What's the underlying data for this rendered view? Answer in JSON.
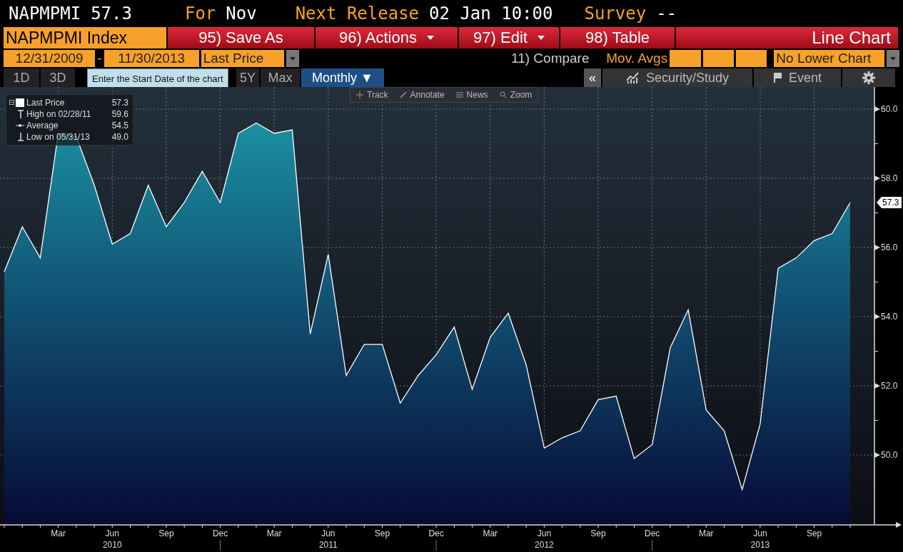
{
  "header": {
    "ticker": "NAPMPMI",
    "value": "57.3",
    "for_label": "For",
    "for_value": "Nov",
    "release_label": "Next Release",
    "release_value": "02 Jan 10:00",
    "survey_label": "Survey",
    "survey_value": "--"
  },
  "security": "NAPMPMI Index",
  "actions": [
    {
      "label": "95) Save As",
      "dropdown": false
    },
    {
      "label": "96) Actions",
      "dropdown": true
    },
    {
      "label": "97) Edit",
      "dropdown": true
    },
    {
      "label": "98) Table",
      "dropdown": false
    }
  ],
  "chart_type": "Line Chart",
  "range": {
    "start": "12/31/2009",
    "separator": "-",
    "end": "11/30/2013",
    "field": "Last Price"
  },
  "compare": "11) Compare",
  "mov_avgs": "Mov. Avgs",
  "lower_chart": "No Lower Chart",
  "periods": [
    {
      "label": "1D",
      "selected": false
    },
    {
      "label": "3D",
      "selected": false
    },
    {
      "label": "5Y",
      "selected": false
    },
    {
      "label": "Max",
      "selected": false
    },
    {
      "label": "Monthly ▼",
      "selected": true
    }
  ],
  "tooltip": "Enter the Start Date of the chart",
  "collapse": "«",
  "panel_tabs": [
    {
      "kind": "study",
      "label": "Security/Study"
    },
    {
      "kind": "event",
      "label": "Event"
    },
    {
      "kind": "settings"
    }
  ],
  "chart_tools": [
    {
      "kind": "track",
      "label": "Track"
    },
    {
      "kind": "annotate",
      "label": "Annotate"
    },
    {
      "kind": "news",
      "label": "News"
    },
    {
      "kind": "zoom",
      "label": "Zoom"
    }
  ],
  "legend": [
    {
      "kind": "series",
      "label": "Last Price",
      "value": "57.3"
    },
    {
      "kind": "high",
      "label": "High on 02/28/11",
      "value": "59.6"
    },
    {
      "kind": "average",
      "label": "Average",
      "value": "54.5"
    },
    {
      "kind": "low",
      "label": "Low on 05/31/13",
      "value": "49.0"
    }
  ],
  "chart": {
    "price_tag": "57.3",
    "year_labels": [
      "2010",
      "2011",
      "2012",
      "2013"
    ],
    "chart_data": {
      "type": "area",
      "grid": true,
      "categories": [
        null,
        null,
        null,
        "Mar",
        null,
        null,
        "Jun",
        null,
        null,
        "Sep",
        null,
        null,
        "Dec",
        null,
        null,
        "Mar",
        null,
        null,
        "Jun",
        null,
        null,
        "Sep",
        null,
        null,
        "Dec",
        null,
        null,
        "Mar",
        null,
        null,
        "Jun",
        null,
        null,
        "Sep",
        null,
        null,
        "Dec",
        null,
        null,
        "Mar",
        null,
        null,
        "Jun",
        null,
        null,
        "Sep",
        null,
        null
      ],
      "series": [
        {
          "color": "#ffffff",
          "values": [
            55.3,
            56.6,
            55.7,
            59.3,
            59.2,
            57.8,
            56.1,
            56.4,
            57.8,
            56.6,
            57.3,
            58.2,
            57.3,
            59.3,
            59.6,
            59.3,
            59.4,
            53.5,
            55.8,
            52.3,
            53.2,
            53.2,
            51.5,
            52.3,
            52.9,
            53.7,
            51.9,
            53.4,
            54.1,
            52.6,
            50.2,
            50.5,
            50.7,
            51.6,
            51.7,
            49.9,
            50.3,
            53.1,
            54.2,
            51.3,
            50.7,
            49.0,
            50.9,
            55.4,
            55.7,
            56.2,
            56.4,
            57.3
          ]
        }
      ],
      "ylim": [
        48,
        60.64
      ],
      "yticks": [
        {
          "value": 50,
          "label": "50.0"
        },
        {
          "value": 52,
          "label": "52.0"
        },
        {
          "value": 54,
          "label": "54.0"
        },
        {
          "value": 56,
          "label": "56.0"
        },
        {
          "value": 58,
          "label": "58.0"
        },
        {
          "value": 60,
          "label": "60.0"
        }
      ]
    }
  }
}
